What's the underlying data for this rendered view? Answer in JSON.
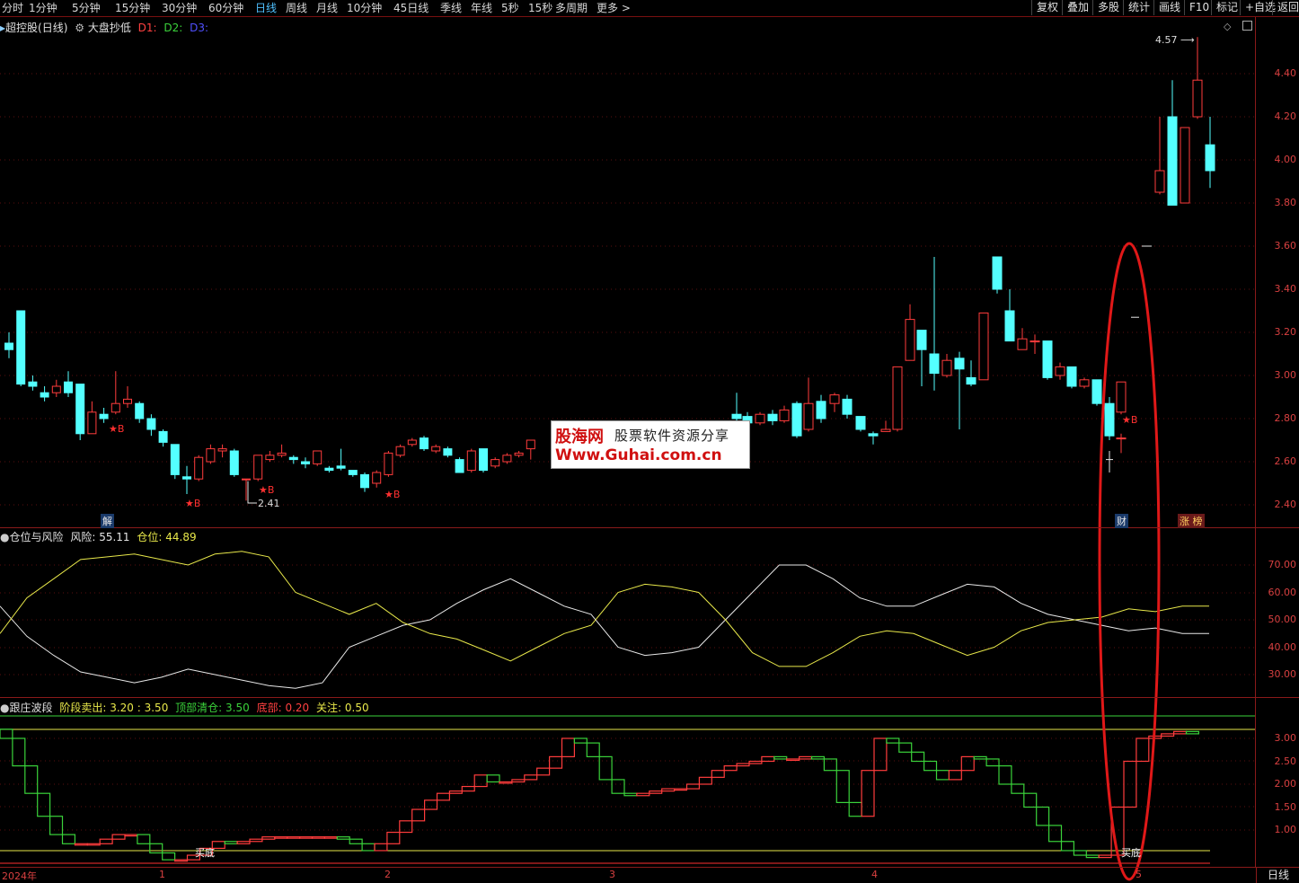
{
  "toolbar": {
    "tabs": [
      "分时",
      "1分钟",
      "5分钟",
      "15分钟",
      "30分钟",
      "60分钟",
      "日线",
      "周线",
      "月线",
      "10分钟",
      "45日线",
      "季线",
      "年线",
      "5秒",
      "15秒",
      "多周期",
      "更多 >"
    ],
    "active": "日线",
    "right_buttons": [
      "复权",
      "叠加",
      "多股",
      "统计",
      "画线",
      "F10",
      "标记",
      "+自选",
      "返回"
    ]
  },
  "main_panel": {
    "title": "超控股(日线)",
    "indicator": "大盘抄低",
    "d1": "D1:",
    "d2": "D2:",
    "d3": "D3:",
    "high_label": "4.57",
    "low_label": "2.41",
    "buy_marker": "★B",
    "tags": {
      "jie": "解",
      "cai": "财",
      "zhangting": "涨 榜"
    },
    "y_ticks": [
      "4.40",
      "4.20",
      "4.00",
      "3.80",
      "3.60",
      "3.40",
      "3.20",
      "3.00",
      "2.80",
      "2.60",
      "2.40"
    ]
  },
  "risk_panel": {
    "title": "仓位与风险",
    "risk_label": "风险:",
    "risk_value": "55.11",
    "pos_label": "仓位:",
    "pos_value": "44.89",
    "y_ticks": [
      "70.00",
      "60.00",
      "50.00",
      "40.00",
      "30.00"
    ]
  },
  "wave_panel": {
    "title": "跟庄波段",
    "sell_label": "阶段卖出:",
    "sell_value": "3.20",
    "sell_value2": ": 3.50",
    "clear_label": "顶部清仓:",
    "clear_value": "3.50",
    "bottom_label": "底部:",
    "bottom_value": "0.20",
    "watch_label": "关注:",
    "watch_value": "0.50",
    "buy_bottom": "买底",
    "y_ticks": [
      "3.00",
      "2.50",
      "2.00",
      "1.50",
      "1.00"
    ]
  },
  "x_axis": [
    "2024年",
    "1",
    "2",
    "3",
    "4",
    "5"
  ],
  "period_button": "日线",
  "watermark": {
    "line1_a": "股海网",
    "line1_b": "股票软件资源分享",
    "line2": "Www.Guhai.com.cn"
  },
  "colors": {
    "up": "#ff3c3c",
    "down": "#54ffff",
    "yellow": "#e8e84a",
    "white": "#e8e8e8",
    "green": "#3ad23a",
    "axis": "#8a1a1a"
  },
  "chart_data": [
    {
      "type": "candlestick",
      "title": "超控股(日线)",
      "ylim": [
        2.3,
        4.6
      ],
      "y_ticks": [
        2.4,
        2.6,
        2.8,
        3.0,
        3.2,
        3.4,
        3.6,
        3.8,
        4.0,
        4.2,
        4.4
      ],
      "candles": [
        [
          3.15,
          3.12,
          3.2,
          3.08
        ],
        [
          3.3,
          2.96,
          3.3,
          2.95
        ],
        [
          2.97,
          2.95,
          3.0,
          2.93
        ],
        [
          2.92,
          2.9,
          2.95,
          2.88
        ],
        [
          2.92,
          2.95,
          2.98,
          2.9
        ],
        [
          2.97,
          2.92,
          3.02,
          2.9
        ],
        [
          2.96,
          2.73,
          2.96,
          2.7
        ],
        [
          2.73,
          2.83,
          2.88,
          2.73
        ],
        [
          2.82,
          2.8,
          2.85,
          2.78
        ],
        [
          2.83,
          2.87,
          3.02,
          2.82
        ],
        [
          2.87,
          2.89,
          2.95,
          2.85
        ],
        [
          2.87,
          2.8,
          2.88,
          2.78
        ],
        [
          2.8,
          2.75,
          2.82,
          2.72
        ],
        [
          2.74,
          2.69,
          2.75,
          2.67
        ],
        [
          2.68,
          2.54,
          2.68,
          2.52
        ],
        [
          2.53,
          2.52,
          2.58,
          2.45
        ],
        [
          2.52,
          2.62,
          2.63,
          2.51
        ],
        [
          2.6,
          2.66,
          2.68,
          2.59
        ],
        [
          2.65,
          2.66,
          2.68,
          2.62
        ],
        [
          2.65,
          2.54,
          2.66,
          2.53
        ],
        [
          2.52,
          2.52,
          2.52,
          2.42
        ],
        [
          2.52,
          2.63,
          2.63,
          2.51
        ],
        [
          2.61,
          2.63,
          2.65,
          2.6
        ],
        [
          2.63,
          2.64,
          2.68,
          2.62
        ],
        [
          2.62,
          2.61,
          2.63,
          2.59
        ],
        [
          2.6,
          2.59,
          2.62,
          2.57
        ],
        [
          2.59,
          2.65,
          2.65,
          2.58
        ],
        [
          2.57,
          2.56,
          2.58,
          2.55
        ],
        [
          2.58,
          2.57,
          2.66,
          2.56
        ],
        [
          2.56,
          2.54,
          2.56,
          2.53
        ],
        [
          2.54,
          2.48,
          2.55,
          2.46
        ],
        [
          2.5,
          2.55,
          2.56,
          2.48
        ],
        [
          2.54,
          2.64,
          2.65,
          2.53
        ],
        [
          2.63,
          2.67,
          2.68,
          2.62
        ],
        [
          2.68,
          2.7,
          2.71,
          2.67
        ],
        [
          2.71,
          2.66,
          2.72,
          2.65
        ],
        [
          2.65,
          2.67,
          2.68,
          2.64
        ],
        [
          2.66,
          2.63,
          2.67,
          2.62
        ],
        [
          2.61,
          2.55,
          2.62,
          2.55
        ],
        [
          2.56,
          2.65,
          2.66,
          2.55
        ],
        [
          2.66,
          2.56,
          2.66,
          2.55
        ],
        [
          2.58,
          2.61,
          2.62,
          2.57
        ],
        [
          2.6,
          2.63,
          2.64,
          2.59
        ],
        [
          2.63,
          2.64,
          2.65,
          2.62
        ],
        [
          2.66,
          2.7,
          2.7,
          2.61
        ]
      ]
    },
    {
      "type": "line",
      "title": "仓位与风险",
      "ylim": [
        24,
        80
      ],
      "series": [
        {
          "name": "风险",
          "values": [
            55,
            44,
            37,
            31,
            29,
            27,
            29,
            32,
            30,
            28,
            26,
            25,
            27,
            40,
            44,
            48,
            50,
            56,
            61,
            65,
            60,
            55,
            52,
            40,
            37,
            38,
            40,
            50,
            60,
            70,
            70,
            65,
            58,
            55,
            55,
            59,
            63,
            62,
            56,
            52,
            50,
            48,
            46,
            47,
            45,
            45
          ]
        },
        {
          "name": "仓位",
          "values": [
            45,
            58,
            65,
            72,
            73,
            74,
            72,
            70,
            74,
            75,
            73,
            60,
            56,
            52,
            56,
            49,
            45,
            43,
            39,
            35,
            40,
            45,
            48,
            60,
            63,
            62,
            60,
            50,
            38,
            33,
            33,
            38,
            44,
            46,
            45,
            41,
            37,
            40,
            46,
            49,
            50,
            51,
            54,
            53,
            55,
            55
          ]
        }
      ]
    }
  ]
}
